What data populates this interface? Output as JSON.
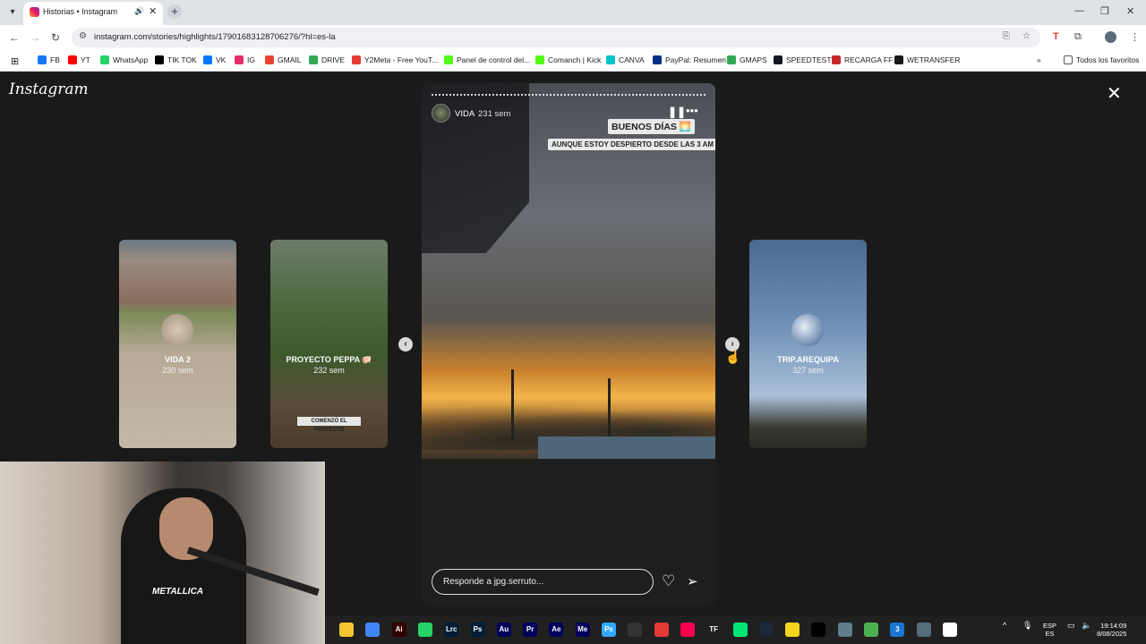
{
  "browser": {
    "tab_title": "Historias • Instagram",
    "url": "instagram.com/stories/highlights/17901683128706276/?hl=es-la",
    "bookmarks": [
      {
        "label": "FB",
        "color": "#1877f2"
      },
      {
        "label": "YT",
        "color": "#ff0000"
      },
      {
        "label": "WhatsApp",
        "color": "#25d366"
      },
      {
        "label": "TIK TOK",
        "color": "#000000"
      },
      {
        "label": "VK",
        "color": "#0077ff"
      },
      {
        "label": "IG",
        "color": "#e1306c"
      },
      {
        "label": "GMAIL",
        "color": "#ea4335"
      },
      {
        "label": "DRIVE",
        "color": "#34a853"
      },
      {
        "label": "Y2Meta - Free YouT...",
        "color": "#e53935"
      },
      {
        "label": "Panel de control del...",
        "color": "#53fc18"
      },
      {
        "label": "Comanch | Kick",
        "color": "#53fc18"
      },
      {
        "label": "CANVA",
        "color": "#00c4cc"
      },
      {
        "label": "PayPal: Resumen",
        "color": "#003087"
      },
      {
        "label": "GMAPS",
        "color": "#34a853"
      },
      {
        "label": "SPEEDTEST",
        "color": "#141526"
      },
      {
        "label": "RECARGA FF",
        "color": "#c62828"
      },
      {
        "label": "WETRANSFER",
        "color": "#17181a"
      }
    ],
    "all_favorites": "Todos los favoritos"
  },
  "instagram": {
    "logo": "Instagram",
    "story": {
      "username": "VIDA",
      "age": "231 sem",
      "caption_title": "BUENOS DÍAS 🌅",
      "caption_sub": "AUNQUE ESTOY DESPIERTO DESDE LAS 3 AM 😅",
      "reply_placeholder": "Responde a jpg.serruto..."
    },
    "previews": [
      {
        "name": "VIDA 2",
        "age": "230 sem"
      },
      {
        "name": "PROYECTO PEPPA 🐖",
        "age": "232 sem",
        "sticker": "COMENZÓ EL PROYECTO"
      },
      {
        "name": "TRIP.AREQUIPA",
        "age": "327 sem"
      }
    ]
  },
  "webcam": {
    "shirt_text": "METALLICA"
  },
  "taskbar": {
    "lang_top": "ESP",
    "lang_bottom": "ES",
    "time": "19:14:09",
    "date": "8/08/2025",
    "apps": [
      {
        "label": "",
        "color": "#f4c430"
      },
      {
        "label": "",
        "color": "#4285f4"
      },
      {
        "label": "Ai",
        "color": "#330000"
      },
      {
        "label": "",
        "color": "#25d366"
      },
      {
        "label": "Lrc",
        "color": "#001e36"
      },
      {
        "label": "Ps",
        "color": "#001e36"
      },
      {
        "label": "Au",
        "color": "#00005b"
      },
      {
        "label": "Pr",
        "color": "#00005b"
      },
      {
        "label": "Ae",
        "color": "#00005b"
      },
      {
        "label": "Me",
        "color": "#00005b"
      },
      {
        "label": "Ps",
        "color": "#31a8ff"
      },
      {
        "label": "",
        "color": "#333333"
      },
      {
        "label": "",
        "color": "#e53935"
      },
      {
        "label": "",
        "color": "#ff0050"
      },
      {
        "label": "TF",
        "color": "#202020"
      },
      {
        "label": "",
        "color": "#00e676"
      },
      {
        "label": "",
        "color": "#1b2838"
      },
      {
        "label": "",
        "color": "#f7d51d"
      },
      {
        "label": "",
        "color": "#000000"
      },
      {
        "label": "",
        "color": "#607d8b"
      },
      {
        "label": "",
        "color": "#4caf50"
      },
      {
        "label": "3",
        "color": "#1976d2"
      },
      {
        "label": "",
        "color": "#546e7a"
      },
      {
        "label": "",
        "color": "#ffffff"
      }
    ]
  }
}
